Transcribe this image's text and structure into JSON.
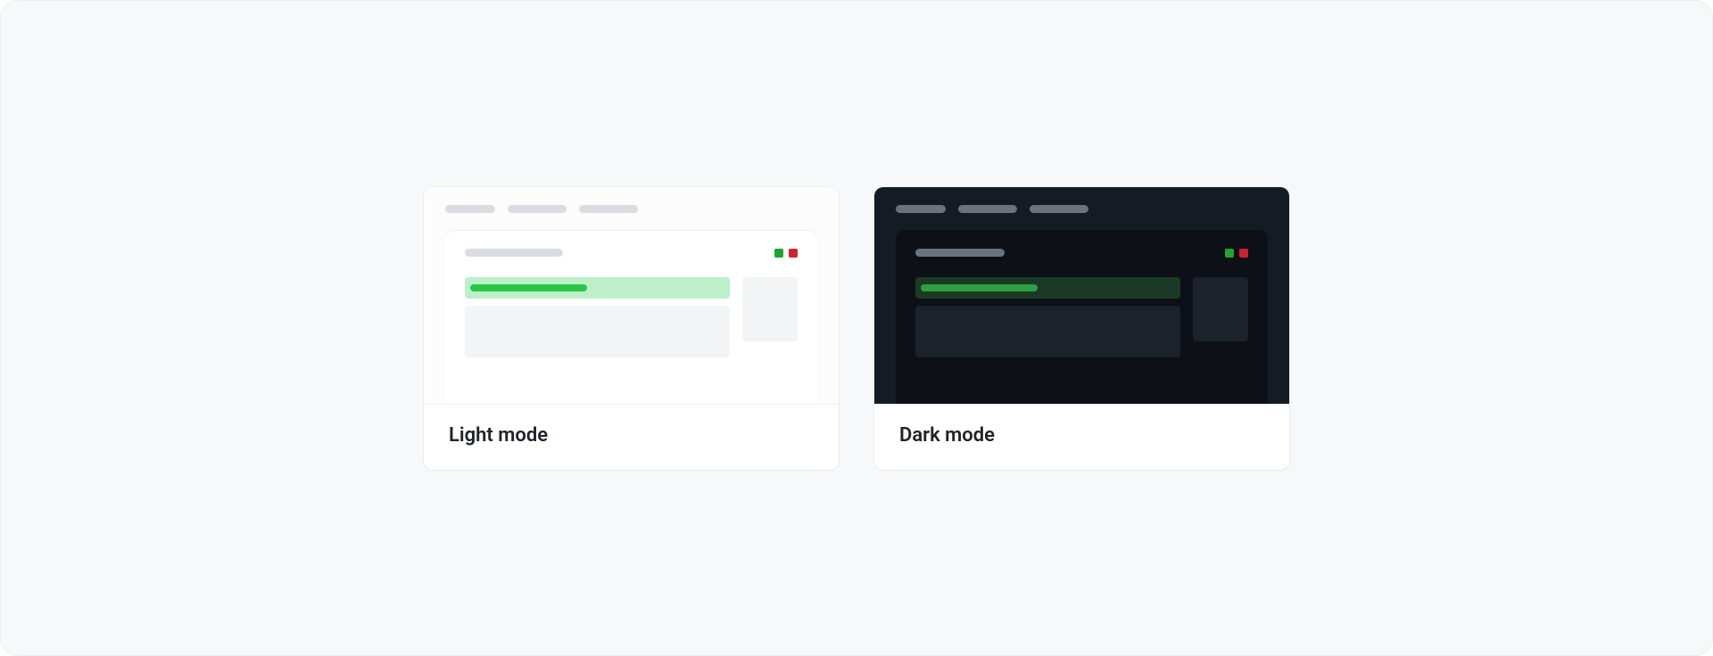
{
  "cards": [
    {
      "mode": "light",
      "label": "Light mode"
    },
    {
      "mode": "dark",
      "label": "Dark mode"
    }
  ],
  "status_colors": {
    "pass": "#1fa42e",
    "fail": "#cf222e"
  }
}
